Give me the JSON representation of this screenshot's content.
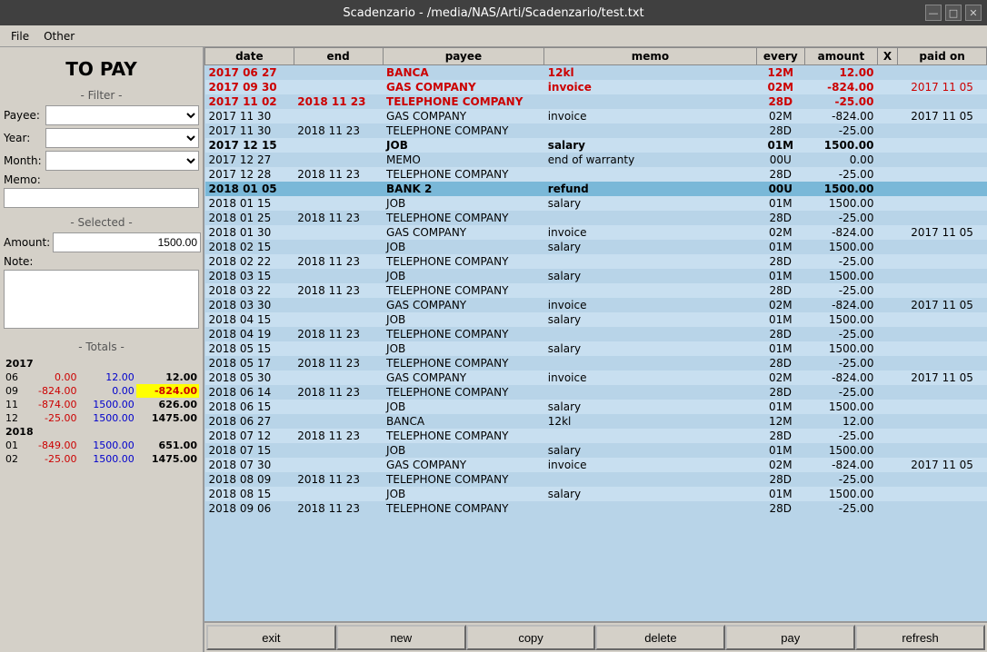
{
  "titlebar": {
    "title": "Scadenzario - /media/NAS/Arti/Scadenzario/test.txt"
  },
  "menubar": {
    "items": [
      "File",
      "Other"
    ]
  },
  "left_panel": {
    "title": "TO PAY",
    "filter_label": "- Filter -",
    "payee_label": "Payee:",
    "year_label": "Year:",
    "month_label": "Month:",
    "memo_label": "Memo:",
    "selected_label": "- Selected -",
    "amount_label": "Amount:",
    "amount_value": "1500.00",
    "note_label": "Note:"
  },
  "totals": {
    "label": "- Totals -",
    "years": [
      {
        "year": "2017",
        "months": [
          {
            "month": "06",
            "col1": "0.00",
            "col1_color": "red",
            "col2": "12.00",
            "col2_color": "blue",
            "col3": "12.00",
            "col3_bold": true
          },
          {
            "month": "09",
            "col1": "-824.00",
            "col1_color": "red",
            "col2": "0.00",
            "col2_color": "blue",
            "col3": "-824.00",
            "col3_yellow": true
          },
          {
            "month": "11",
            "col1": "-874.00",
            "col1_color": "red",
            "col2": "1500.00",
            "col2_color": "blue",
            "col3": "626.00",
            "col3_bold": true
          },
          {
            "month": "12",
            "col1": "-25.00",
            "col1_color": "red",
            "col2": "1500.00",
            "col2_color": "blue",
            "col3": "1475.00",
            "col3_bold": true
          }
        ]
      },
      {
        "year": "2018",
        "months": [
          {
            "month": "01",
            "col1": "-849.00",
            "col1_color": "red",
            "col2": "1500.00",
            "col2_color": "blue",
            "col3": "651.00",
            "col3_bold": true
          },
          {
            "month": "02",
            "col1": "-25.00",
            "col1_color": "red",
            "col2": "1500.00",
            "col2_color": "blue",
            "col3": "1475.00",
            "col3_bold": true
          }
        ]
      }
    ]
  },
  "table": {
    "headers": [
      "date",
      "end",
      "payee",
      "memo",
      "every",
      "amount",
      "X",
      "paid on"
    ],
    "rows": [
      {
        "date": "2017 06 27",
        "end": "",
        "payee": "BANCA",
        "memo": "12kl",
        "every": "12M",
        "amount": "12.00",
        "x": "",
        "paidon": "",
        "bold": true,
        "date_red": true,
        "payee_red": true,
        "memo_red": true,
        "every_red": true,
        "amount_red": true
      },
      {
        "date": "2017 09 30",
        "end": "",
        "payee": "GAS COMPANY",
        "memo": "invoice",
        "every": "02M",
        "amount": "-824.00",
        "x": "",
        "paidon": "2017 11 05",
        "bold": true,
        "date_red": true,
        "payee_red": true,
        "memo_red": true,
        "every_red": true,
        "amount_red": true,
        "paidon_red": true
      },
      {
        "date": "2017 11 02",
        "end": "2018 11 23",
        "payee": "TELEPHONE COMPANY",
        "memo": "",
        "every": "28D",
        "amount": "-25.00",
        "x": "",
        "paidon": "",
        "bold": true,
        "date_red": true,
        "end_red": true,
        "payee_red": true,
        "every_red": true,
        "amount_red": true
      },
      {
        "date": "2017 11 30",
        "end": "",
        "payee": "GAS COMPANY",
        "memo": "invoice",
        "every": "02M",
        "amount": "-824.00",
        "x": "",
        "paidon": "2017 11 05",
        "bold": false
      },
      {
        "date": "2017 11 30",
        "end": "2018 11 23",
        "payee": "TELEPHONE COMPANY",
        "memo": "",
        "every": "28D",
        "amount": "-25.00",
        "x": "",
        "paidon": "",
        "bold": false
      },
      {
        "date": "2017 12 15",
        "end": "",
        "payee": "JOB",
        "memo": "salary",
        "every": "01M",
        "amount": "1500.00",
        "x": "",
        "paidon": "",
        "bold": true
      },
      {
        "date": "2017 12 27",
        "end": "",
        "payee": "MEMO",
        "memo": "end of warranty",
        "every": "00U",
        "amount": "0.00",
        "x": "",
        "paidon": "",
        "bold": false
      },
      {
        "date": "2017 12 28",
        "end": "2018 11 23",
        "payee": "TELEPHONE COMPANY",
        "memo": "",
        "every": "28D",
        "amount": "-25.00",
        "x": "",
        "paidon": "",
        "bold": false
      },
      {
        "date": "2018 01 05",
        "end": "",
        "payee": "BANK 2",
        "memo": "refund",
        "every": "00U",
        "amount": "1500.00",
        "x": "",
        "paidon": "",
        "bold": true
      },
      {
        "date": "2018 01 15",
        "end": "",
        "payee": "JOB",
        "memo": "salary",
        "every": "01M",
        "amount": "1500.00",
        "x": "",
        "paidon": "",
        "bold": false
      },
      {
        "date": "2018 01 25",
        "end": "2018 11 23",
        "payee": "TELEPHONE COMPANY",
        "memo": "",
        "every": "28D",
        "amount": "-25.00",
        "x": "",
        "paidon": "",
        "bold": false
      },
      {
        "date": "2018 01 30",
        "end": "",
        "payee": "GAS COMPANY",
        "memo": "invoice",
        "every": "02M",
        "amount": "-824.00",
        "x": "",
        "paidon": "2017 11 05",
        "bold": false
      },
      {
        "date": "2018 02 15",
        "end": "",
        "payee": "JOB",
        "memo": "salary",
        "every": "01M",
        "amount": "1500.00",
        "x": "",
        "paidon": "",
        "bold": false
      },
      {
        "date": "2018 02 22",
        "end": "2018 11 23",
        "payee": "TELEPHONE COMPANY",
        "memo": "",
        "every": "28D",
        "amount": "-25.00",
        "x": "",
        "paidon": "",
        "bold": false
      },
      {
        "date": "2018 03 15",
        "end": "",
        "payee": "JOB",
        "memo": "salary",
        "every": "01M",
        "amount": "1500.00",
        "x": "",
        "paidon": "",
        "bold": false
      },
      {
        "date": "2018 03 22",
        "end": "2018 11 23",
        "payee": "TELEPHONE COMPANY",
        "memo": "",
        "every": "28D",
        "amount": "-25.00",
        "x": "",
        "paidon": "",
        "bold": false
      },
      {
        "date": "2018 03 30",
        "end": "",
        "payee": "GAS COMPANY",
        "memo": "invoice",
        "every": "02M",
        "amount": "-824.00",
        "x": "",
        "paidon": "2017 11 05",
        "bold": false
      },
      {
        "date": "2018 04 15",
        "end": "",
        "payee": "JOB",
        "memo": "salary",
        "every": "01M",
        "amount": "1500.00",
        "x": "",
        "paidon": "",
        "bold": false
      },
      {
        "date": "2018 04 19",
        "end": "2018 11 23",
        "payee": "TELEPHONE COMPANY",
        "memo": "",
        "every": "28D",
        "amount": "-25.00",
        "x": "",
        "paidon": "",
        "bold": false
      },
      {
        "date": "2018 05 15",
        "end": "",
        "payee": "JOB",
        "memo": "salary",
        "every": "01M",
        "amount": "1500.00",
        "x": "",
        "paidon": "",
        "bold": false
      },
      {
        "date": "2018 05 17",
        "end": "2018 11 23",
        "payee": "TELEPHONE COMPANY",
        "memo": "",
        "every": "28D",
        "amount": "-25.00",
        "x": "",
        "paidon": "",
        "bold": false
      },
      {
        "date": "2018 05 30",
        "end": "",
        "payee": "GAS COMPANY",
        "memo": "invoice",
        "every": "02M",
        "amount": "-824.00",
        "x": "",
        "paidon": "2017 11 05",
        "bold": false
      },
      {
        "date": "2018 06 14",
        "end": "2018 11 23",
        "payee": "TELEPHONE COMPANY",
        "memo": "",
        "every": "28D",
        "amount": "-25.00",
        "x": "",
        "paidon": "",
        "bold": false
      },
      {
        "date": "2018 06 15",
        "end": "",
        "payee": "JOB",
        "memo": "salary",
        "every": "01M",
        "amount": "1500.00",
        "x": "",
        "paidon": "",
        "bold": false
      },
      {
        "date": "2018 06 27",
        "end": "",
        "payee": "BANCA",
        "memo": "12kl",
        "every": "12M",
        "amount": "12.00",
        "x": "",
        "paidon": "",
        "bold": false
      },
      {
        "date": "2018 07 12",
        "end": "2018 11 23",
        "payee": "TELEPHONE COMPANY",
        "memo": "",
        "every": "28D",
        "amount": "-25.00",
        "x": "",
        "paidon": "",
        "bold": false
      },
      {
        "date": "2018 07 15",
        "end": "",
        "payee": "JOB",
        "memo": "salary",
        "every": "01M",
        "amount": "1500.00",
        "x": "",
        "paidon": "",
        "bold": false
      },
      {
        "date": "2018 07 30",
        "end": "",
        "payee": "GAS COMPANY",
        "memo": "invoice",
        "every": "02M",
        "amount": "-824.00",
        "x": "",
        "paidon": "2017 11 05",
        "bold": false
      },
      {
        "date": "2018 08 09",
        "end": "2018 11 23",
        "payee": "TELEPHONE COMPANY",
        "memo": "",
        "every": "28D",
        "amount": "-25.00",
        "x": "",
        "paidon": "",
        "bold": false
      },
      {
        "date": "2018 08 15",
        "end": "",
        "payee": "JOB",
        "memo": "salary",
        "every": "01M",
        "amount": "1500.00",
        "x": "",
        "paidon": "",
        "bold": false
      },
      {
        "date": "2018 09 06",
        "end": "2018 11 23",
        "payee": "TELEPHONE COMPANY",
        "memo": "",
        "every": "28D",
        "amount": "-25.00",
        "x": "",
        "paidon": "",
        "bold": false
      }
    ]
  },
  "buttons": {
    "exit": "exit",
    "new": "new",
    "copy": "copy",
    "delete": "delete",
    "pay": "pay",
    "refresh": "refresh"
  }
}
